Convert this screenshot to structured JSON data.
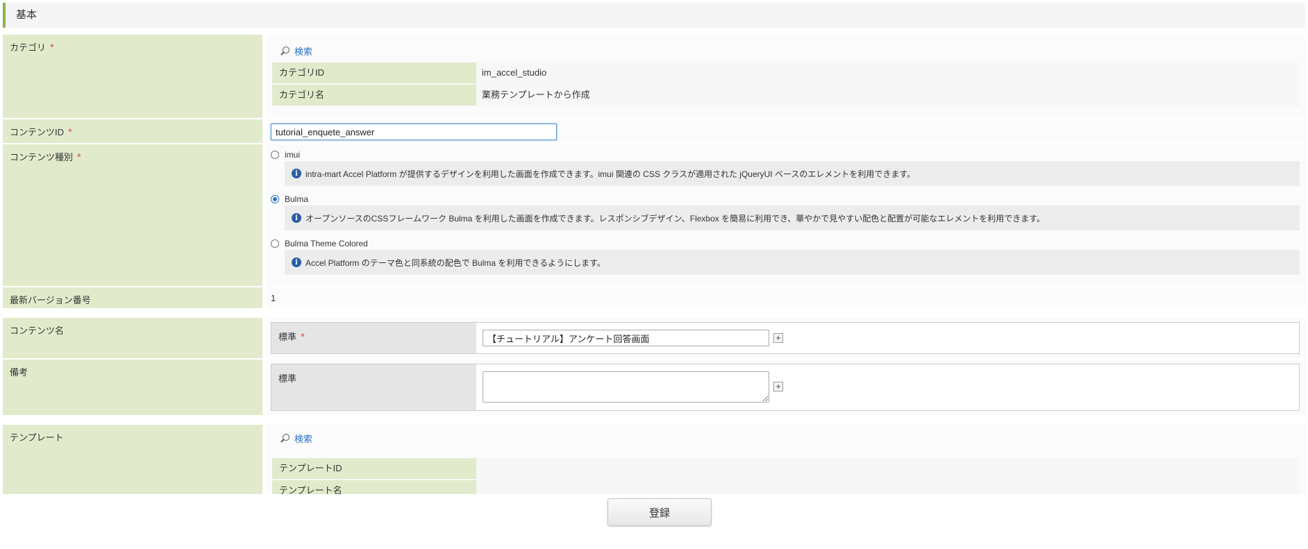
{
  "section": {
    "title": "基本"
  },
  "category": {
    "label": "カテゴリ",
    "required_mark": "*",
    "search_label": "検索",
    "rows": [
      {
        "key": "カテゴリID",
        "value": "im_accel_studio"
      },
      {
        "key": "カテゴリ名",
        "value": "業務テンプレートから作成"
      }
    ]
  },
  "content_id": {
    "label": "コンテンツID",
    "required_mark": "*",
    "value": "tutorial_enquete_answer"
  },
  "content_type": {
    "label": "コンテンツ種別",
    "required_mark": "*",
    "selected": "Bulma",
    "options": [
      {
        "label": "imui",
        "description": "intra-mart Accel Platform が提供するデザインを利用した画面を作成できます。imui 関連の CSS クラスが適用された jQueryUI ベースのエレメントを利用できます。"
      },
      {
        "label": "Bulma",
        "description": "オープンソースのCSSフレームワーク Bulma を利用した画面を作成できます。レスポンシブデザイン、Flexbox を簡易に利用でき、華やかで見やすい配色と配置が可能なエレメントを利用できます。"
      },
      {
        "label": "Bulma Theme Colored",
        "description": "Accel Platform のテーマ色と同系統の配色で Bulma を利用できるようにします。"
      }
    ]
  },
  "latest_version": {
    "label": "最新バージョン番号",
    "value": "1"
  },
  "content_name": {
    "label": "コンテンツ名",
    "sub_label": "標準",
    "required_mark": "*",
    "value": "【チュートリアル】アンケート回答画面",
    "add_label": "+"
  },
  "remarks": {
    "label": "備考",
    "sub_label": "標準",
    "value": "",
    "add_label": "+"
  },
  "template": {
    "label": "テンプレート",
    "search_label": "検索",
    "rows": [
      {
        "key": "テンプレートID",
        "value": ""
      },
      {
        "key": "テンプレート名",
        "value": ""
      }
    ]
  },
  "actions": {
    "submit_label": "登録"
  },
  "colors": {
    "label_bg": "#e1ebcb",
    "accent": "#8ab34a",
    "link": "#2a72c4",
    "required": "#d9534f"
  }
}
